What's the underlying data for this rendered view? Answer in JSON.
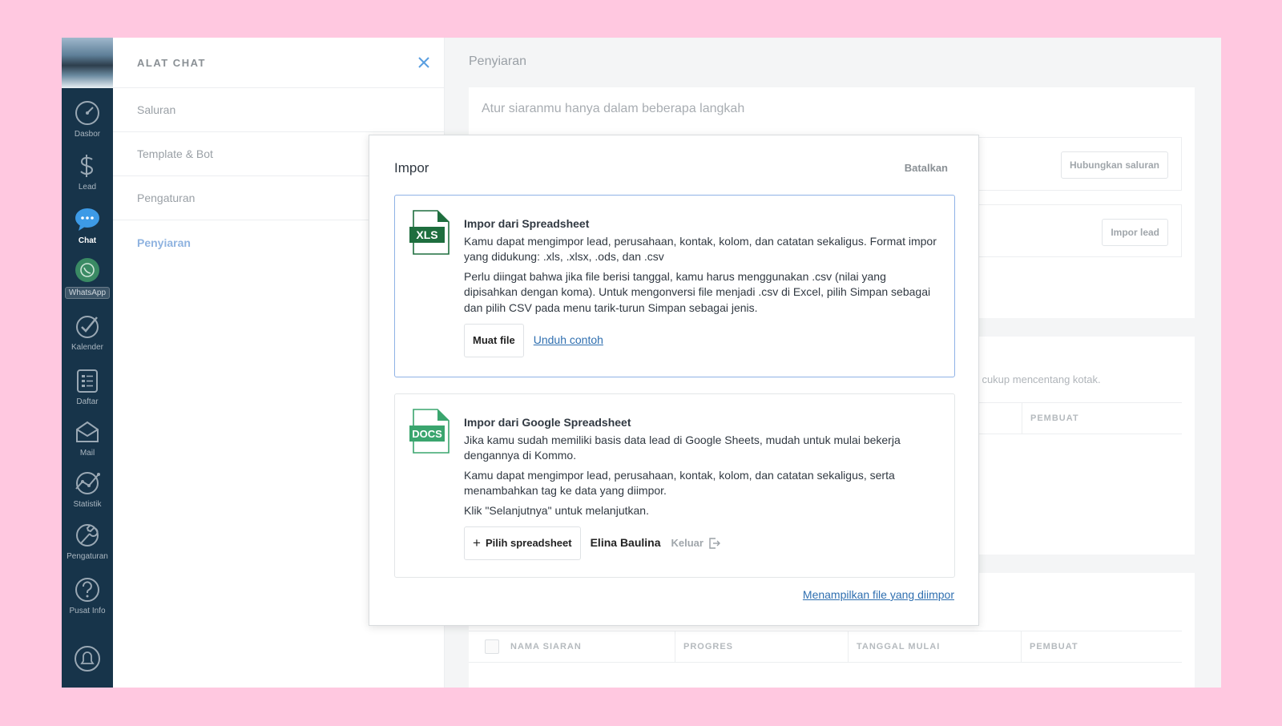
{
  "rail": {
    "items": [
      {
        "label": "Dasbor",
        "icon": "dashboard-icon"
      },
      {
        "label": "Lead",
        "icon": "dollar-icon"
      },
      {
        "label": "Chat",
        "icon": "chat-bubble-icon"
      },
      {
        "label": "WhatsApp",
        "icon": "whatsapp-icon"
      },
      {
        "label": "Kalender",
        "icon": "checkmark-icon"
      },
      {
        "label": "Daftar",
        "icon": "list-icon"
      },
      {
        "label": "Mail",
        "icon": "mail-icon"
      },
      {
        "label": "Statistik",
        "icon": "statistics-icon"
      },
      {
        "label": "Pengaturan",
        "icon": "wrench-icon"
      },
      {
        "label": "Pusat Info",
        "icon": "help-icon"
      }
    ]
  },
  "panel": {
    "title": "ALAT CHAT",
    "items": [
      "Saluran",
      "Template & Bot",
      "Pengaturan",
      "Penyiaran"
    ]
  },
  "main": {
    "title": "Penyiaran",
    "subtitle": "Atur siaranmu hanya dalam beberapa langkah",
    "connect_button": "Hubungkan saluran",
    "import_button": "Impor lead",
    "hint_fragment": "a, cukup mencentang kotak.",
    "columns": [
      "NAMA SIARAN",
      "PROGRES",
      "TANGGAL MULAI",
      "PEMBUAT"
    ],
    "column_fragment_top": "PEMBUAT"
  },
  "modal": {
    "title": "Impor",
    "cancel": "Batalkan",
    "spreadsheet": {
      "icon_label": "XLS",
      "title": "Impor dari Spreadsheet",
      "p1": "Kamu dapat mengimpor lead, perusahaan, kontak, kolom, dan catatan sekaligus. Format impor yang didukung: .xls, .xlsx, .ods, dan .csv",
      "p2": "Perlu diingat bahwa jika file berisi tanggal, kamu harus menggunakan .csv (nilai yang dipisahkan dengan koma). Untuk mengonversi file menjadi .csv di Excel, pilih Simpan sebagai dan pilih CSV pada menu tarik-turun Simpan sebagai jenis.",
      "upload": "Muat file",
      "sample": "Unduh contoh"
    },
    "google": {
      "icon_label": "DOCS",
      "title": "Impor dari Google Spreadsheet",
      "p1": "Jika kamu sudah memiliki basis data lead di Google Sheets, mudah untuk mulai bekerja dengannya di Kommo.",
      "p2": "Kamu dapat mengimpor lead, perusahaan, kontak, kolom, dan catatan sekaligus, serta menambahkan tag ke data yang diimpor.",
      "p3": "Klik \"Selanjutnya\" untuk melanjutkan.",
      "choose": "Pilih spreadsheet",
      "user": "Elina Baulina",
      "logout": "Keluar"
    },
    "imported_link": "Menampilkan file yang diimpor"
  },
  "colors": {
    "rail": "#17344a",
    "accent_link": "#2f6fb0",
    "xls_green": "#1e6e3e",
    "docs_green": "#3aa56e",
    "page_bg": "#ffc8e0"
  }
}
